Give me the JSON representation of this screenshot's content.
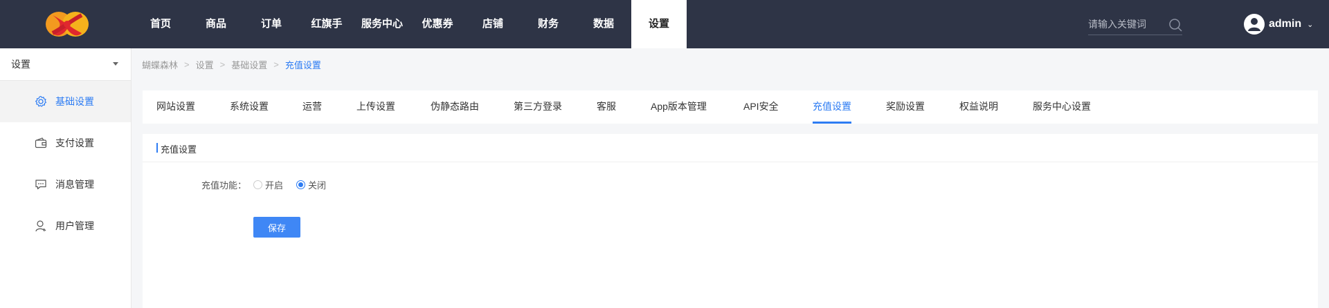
{
  "header": {
    "logo": "logo-icon",
    "nav": [
      {
        "label": "首页"
      },
      {
        "label": "商品"
      },
      {
        "label": "订单"
      },
      {
        "label": "红旗手"
      },
      {
        "label": "服务中心"
      },
      {
        "label": "优惠券"
      },
      {
        "label": "店铺"
      },
      {
        "label": "财务"
      },
      {
        "label": "数据"
      },
      {
        "label": "设置",
        "active": true
      }
    ],
    "search": {
      "placeholder": "请输入关键词",
      "value": "",
      "icon": "search-icon"
    },
    "user": {
      "name": "admin",
      "avatar_icon": "user-avatar-icon",
      "caret_icon": "chevron-down-icon"
    }
  },
  "sidebar": {
    "select_label": "设置",
    "items": [
      {
        "label": "基础设置",
        "icon": "gear-icon",
        "active": true
      },
      {
        "label": "支付设置",
        "icon": "wallet-icon"
      },
      {
        "label": "消息管理",
        "icon": "message-icon"
      },
      {
        "label": "用户管理",
        "icon": "user-icon"
      }
    ]
  },
  "breadcrumb": [
    "蝴蝶森林",
    "设置",
    "基础设置",
    "充值设置"
  ],
  "tabs": [
    {
      "label": "网站设置"
    },
    {
      "label": "系统设置"
    },
    {
      "label": "运营"
    },
    {
      "label": "上传设置"
    },
    {
      "label": "伪静态路由"
    },
    {
      "label": "第三方登录"
    },
    {
      "label": "客服"
    },
    {
      "label": "App版本管理"
    },
    {
      "label": "API安全"
    },
    {
      "label": "充值设置",
      "active": true
    },
    {
      "label": "奖励设置"
    },
    {
      "label": "权益说明"
    },
    {
      "label": "服务中心设置"
    }
  ],
  "content": {
    "section_title": "充值设置",
    "recharge": {
      "label": "充值功能：",
      "options": [
        {
          "label": "开启",
          "checked": false
        },
        {
          "label": "关闭",
          "checked": true
        }
      ]
    },
    "save_label": "保存"
  },
  "colors": {
    "topbar": "#2e3446",
    "accent": "#2d7cf3",
    "button": "#3f87f5",
    "page_bg": "#f5f6f8"
  }
}
